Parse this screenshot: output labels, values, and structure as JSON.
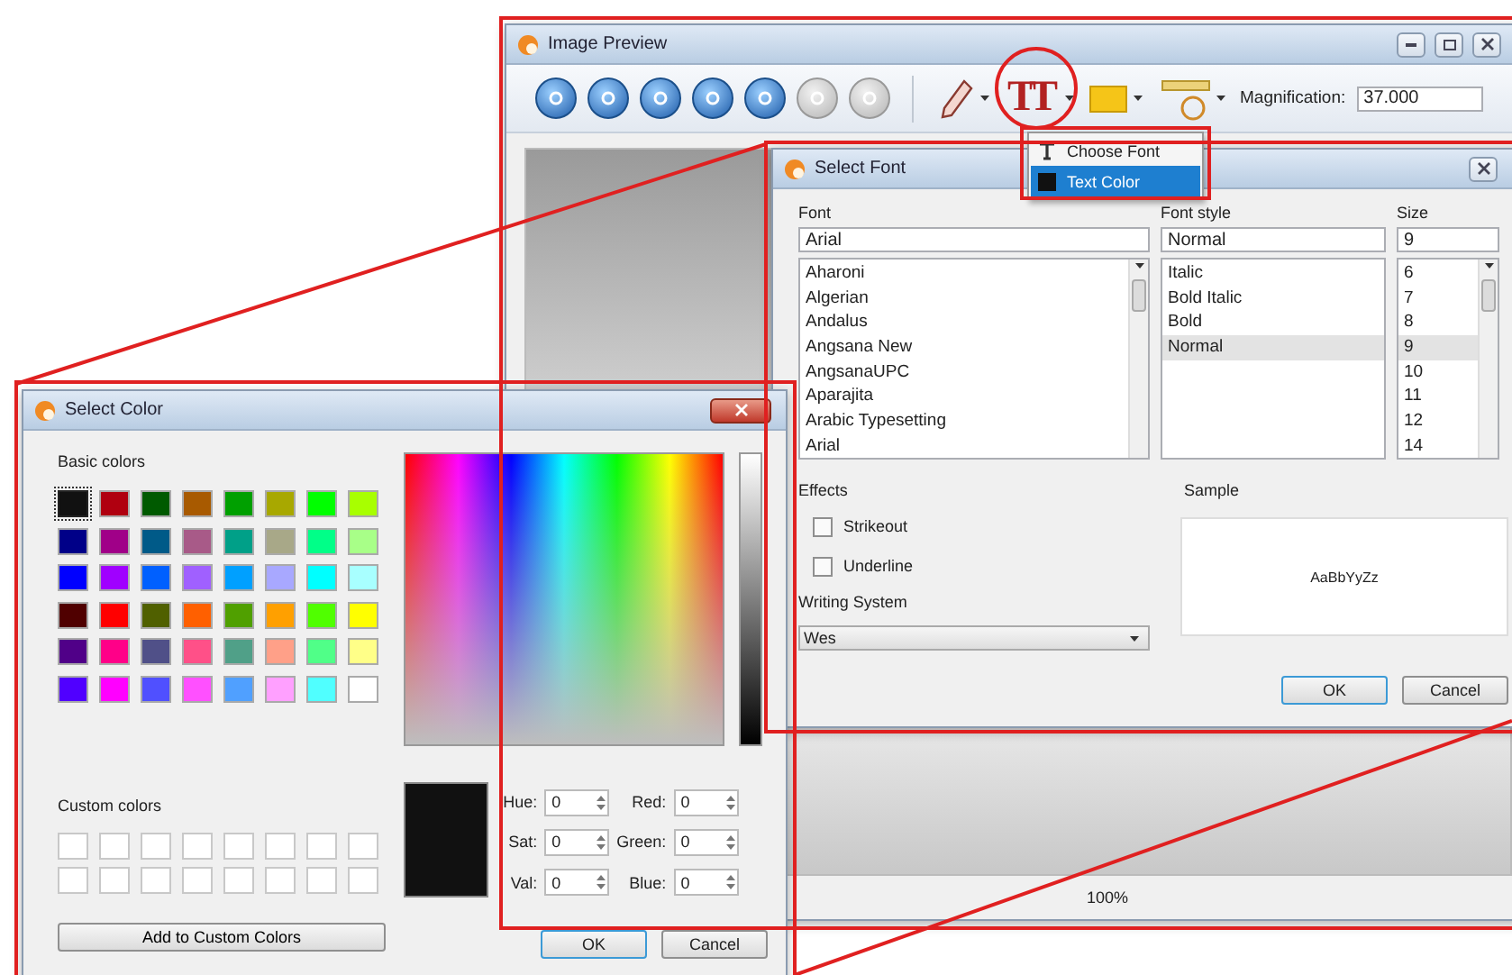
{
  "image_preview": {
    "title": "Image Preview",
    "text_tool_glyph": "TT",
    "magnification_label": "Magnification:",
    "magnification": "37.000",
    "zoom": "100%"
  },
  "text_menu": {
    "items": [
      {
        "label": "Choose Font",
        "kind": "font",
        "selected": false
      },
      {
        "label": "Text Color",
        "kind": "color",
        "selected": true
      }
    ]
  },
  "select_font": {
    "title": "Select Font",
    "font_label": "Font",
    "font_value": "Arial",
    "style_label": "Font style",
    "style_value": "Normal",
    "size_label": "Size",
    "size_value": "9",
    "fonts": [
      {
        "label": "Aharoni",
        "selected": false
      },
      {
        "label": "Algerian",
        "selected": false
      },
      {
        "label": "Andalus",
        "selected": false
      },
      {
        "label": "Angsana New",
        "selected": false
      },
      {
        "label": "AngsanaUPC",
        "selected": false
      },
      {
        "label": "Aparajita",
        "selected": false
      },
      {
        "label": "Arabic Typesetting",
        "selected": false
      },
      {
        "label": "Arial",
        "selected": false
      }
    ],
    "styles": [
      {
        "label": "Italic",
        "selected": false
      },
      {
        "label": "Bold Italic",
        "selected": false
      },
      {
        "label": "Bold",
        "selected": false
      },
      {
        "label": "Normal",
        "selected": true
      }
    ],
    "sizes": [
      {
        "label": "6",
        "selected": false
      },
      {
        "label": "7",
        "selected": false
      },
      {
        "label": "8",
        "selected": false
      },
      {
        "label": "9",
        "selected": true
      },
      {
        "label": "10",
        "selected": false
      },
      {
        "label": "11",
        "selected": false
      },
      {
        "label": "12",
        "selected": false
      },
      {
        "label": "14",
        "selected": false
      }
    ],
    "effects_label": "Effects",
    "effects": [
      {
        "label": "Strikeout",
        "checked": false
      },
      {
        "label": "Underline",
        "checked": false
      }
    ],
    "writing_system_label": "Writing System",
    "writing_system": "Wes",
    "sample_label": "Sample",
    "sample_text": "AaBbYyZz",
    "buttons": [
      "OK",
      "Cancel"
    ]
  },
  "select_color": {
    "title": "Select Color",
    "basic_label": "Basic colors",
    "basic_colors": [
      {
        "color": "#111111",
        "selected": true
      },
      {
        "color": "#b00010",
        "selected": false
      },
      {
        "color": "#005a00",
        "selected": false
      },
      {
        "color": "#a85a00",
        "selected": false
      },
      {
        "color": "#00a000",
        "selected": false
      },
      {
        "color": "#a8a800",
        "selected": false
      },
      {
        "color": "#00ff00",
        "selected": false
      },
      {
        "color": "#a8ff00",
        "selected": false
      },
      {
        "color": "#000088",
        "selected": false
      },
      {
        "color": "#a00088",
        "selected": false
      },
      {
        "color": "#005a88",
        "selected": false
      },
      {
        "color": "#a85a88",
        "selected": false
      },
      {
        "color": "#00a088",
        "selected": false
      },
      {
        "color": "#a8a888",
        "selected": false
      },
      {
        "color": "#00ff88",
        "selected": false
      },
      {
        "color": "#a8ff88",
        "selected": false
      },
      {
        "color": "#0000ff",
        "selected": false
      },
      {
        "color": "#a000ff",
        "selected": false
      },
      {
        "color": "#0060ff",
        "selected": false
      },
      {
        "color": "#a060ff",
        "selected": false
      },
      {
        "color": "#00a0ff",
        "selected": false
      },
      {
        "color": "#a8a8ff",
        "selected": false
      },
      {
        "color": "#00ffff",
        "selected": false
      },
      {
        "color": "#a8ffff",
        "selected": false
      },
      {
        "color": "#500000",
        "selected": false
      },
      {
        "color": "#ff0000",
        "selected": false
      },
      {
        "color": "#506000",
        "selected": false
      },
      {
        "color": "#ff6000",
        "selected": false
      },
      {
        "color": "#50a000",
        "selected": false
      },
      {
        "color": "#ffa000",
        "selected": false
      },
      {
        "color": "#50ff00",
        "selected": false
      },
      {
        "color": "#ffff00",
        "selected": false
      },
      {
        "color": "#500088",
        "selected": false
      },
      {
        "color": "#ff0088",
        "selected": false
      },
      {
        "color": "#505088",
        "selected": false
      },
      {
        "color": "#ff5088",
        "selected": false
      },
      {
        "color": "#50a088",
        "selected": false
      },
      {
        "color": "#ffa088",
        "selected": false
      },
      {
        "color": "#50ff88",
        "selected": false
      },
      {
        "color": "#ffff88",
        "selected": false
      },
      {
        "color": "#5000ff",
        "selected": false
      },
      {
        "color": "#ff00ff",
        "selected": false
      },
      {
        "color": "#5050ff",
        "selected": false
      },
      {
        "color": "#ff50ff",
        "selected": false
      },
      {
        "color": "#50a0ff",
        "selected": false
      },
      {
        "color": "#ffa0ff",
        "selected": false
      },
      {
        "color": "#50ffff",
        "selected": false
      },
      {
        "color": "#ffffff",
        "selected": false
      }
    ],
    "custom_label": "Custom colors",
    "add_button": "Add to Custom Colors",
    "fields": [
      {
        "label": "Hue:",
        "value": "0"
      },
      {
        "label": "Red:",
        "value": "0"
      },
      {
        "label": "Sat:",
        "value": "0"
      },
      {
        "label": "Green:",
        "value": "0"
      },
      {
        "label": "Val:",
        "value": "0"
      },
      {
        "label": "Blue:",
        "value": "0"
      }
    ],
    "buttons": [
      "OK",
      "Cancel"
    ]
  }
}
